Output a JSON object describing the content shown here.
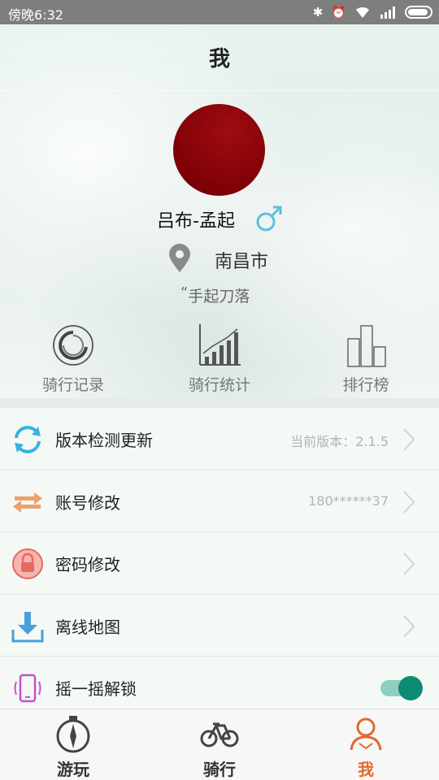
{
  "status_bar": {
    "time": "傍晚6:32",
    "icons": [
      "bluetooth-icon",
      "alarm-icon",
      "wifi-icon",
      "signal-icon",
      "battery-icon"
    ]
  },
  "header": {
    "title": "我"
  },
  "profile": {
    "username": "吕布-孟起",
    "gender": "male",
    "city": "南昌市",
    "signature": "手起刀落",
    "avatar_color": "#8b0508"
  },
  "stats": [
    {
      "label": "骑行记录",
      "icon": "ride-record-icon"
    },
    {
      "label": "骑行统计",
      "icon": "ride-stats-icon"
    },
    {
      "label": "排行榜",
      "icon": "leaderboard-icon"
    }
  ],
  "menu": [
    {
      "label": "版本检测更新",
      "value": "当前版本：2.1.5",
      "icon": "refresh-icon"
    },
    {
      "label": "账号修改",
      "value": "180******37",
      "icon": "swap-icon"
    },
    {
      "label": "密码修改",
      "value": "",
      "icon": "lock-icon"
    },
    {
      "label": "离线地图",
      "value": "",
      "icon": "download-icon"
    },
    {
      "label": "摇一摇解锁",
      "value": "",
      "icon": "phone-shake-icon",
      "toggle_on": true
    }
  ],
  "tabs": [
    {
      "label": "游玩",
      "icon": "compass-icon",
      "active": false
    },
    {
      "label": "骑行",
      "icon": "bicycle-icon",
      "active": false
    },
    {
      "label": "我",
      "icon": "person-icon",
      "active": true
    }
  ],
  "colors": {
    "accent": "#e06a2c",
    "toggle_on": "#0b8c72",
    "gender_male": "#5bc0e0"
  }
}
